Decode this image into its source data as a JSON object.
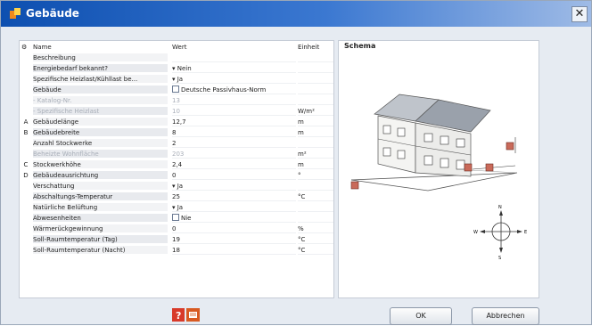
{
  "window": {
    "title": "Gebäude",
    "close_label": "✕"
  },
  "table": {
    "headers": {
      "name": "Name",
      "value": "Wert",
      "unit": "Einheit"
    },
    "rows": [
      {
        "mark": "",
        "name": "Beschreibung",
        "value": "",
        "unit": ""
      },
      {
        "mark": "",
        "name": "Energiebedarf bekannt?",
        "value": "▾ Nein",
        "unit": ""
      },
      {
        "mark": "",
        "name": "Spezifische Heizlast/Kühllast be...",
        "value": "▾ Ja",
        "unit": ""
      },
      {
        "mark": "",
        "name": "Gebäude",
        "value": "Deutsche Passivhaus-Norm",
        "unit": "",
        "check": true
      },
      {
        "mark": "",
        "name": "- Katalog-Nr.",
        "value": "13",
        "unit": "",
        "disabled": true
      },
      {
        "mark": "",
        "name": "- Spezifische Heizlast",
        "value": "10",
        "unit": "W/m²",
        "disabled": true
      },
      {
        "mark": "A",
        "name": "Gebäudelänge",
        "value": "12,7",
        "unit": "m"
      },
      {
        "mark": "B",
        "name": "Gebäudebreite",
        "value": "8",
        "unit": "m"
      },
      {
        "mark": "",
        "name": "Anzahl Stockwerke",
        "value": "2",
        "unit": ""
      },
      {
        "mark": "",
        "name": "Beheizte Wohnfläche",
        "value": "203",
        "unit": "m²",
        "disabled": true
      },
      {
        "mark": "C",
        "name": "Stockwerkhöhe",
        "value": "2,4",
        "unit": "m"
      },
      {
        "mark": "D",
        "name": "Gebäudeausrichtung",
        "value": "0",
        "unit": "°"
      },
      {
        "mark": "",
        "name": "Verschattung",
        "value": "▾ Ja",
        "unit": ""
      },
      {
        "mark": "",
        "name": "Abschaltungs-Temperatur",
        "value": "25",
        "unit": "°C"
      },
      {
        "mark": "",
        "name": "Natürliche Belüftung",
        "value": "▾ Ja",
        "unit": ""
      },
      {
        "mark": "",
        "name": "Abwesenheiten",
        "value": "Nie",
        "unit": "",
        "check": true
      },
      {
        "mark": "",
        "name": "Wärmerückgewinnung",
        "value": "0",
        "unit": "%"
      },
      {
        "mark": "",
        "name": "Soll-Raumtemperatur (Tag)",
        "value": "19",
        "unit": "°C"
      },
      {
        "mark": "",
        "name": "Soll-Raumtemperatur (Nacht)",
        "value": "18",
        "unit": "°C"
      }
    ]
  },
  "schema": {
    "title": "Schema",
    "compass": {
      "n": "N",
      "s": "S",
      "e": "E",
      "w": "W"
    },
    "markers": [
      "A",
      "B",
      "C",
      "D"
    ]
  },
  "footer": {
    "ok_label": "OK",
    "cancel_label": "Abbrechen",
    "icons": [
      "help-icon",
      "export-pdf-icon"
    ]
  },
  "colors": {
    "title_bar": "#0d4fb0",
    "marker_red": "#b33a2a"
  }
}
